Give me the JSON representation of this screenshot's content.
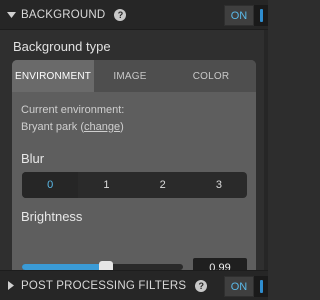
{
  "background_section": {
    "title": "BACKGROUND",
    "toggle_label": "ON",
    "help_glyph": "?",
    "background_type_label": "Background type",
    "tabs": [
      {
        "label": "ENVIRONMENT",
        "active": true
      },
      {
        "label": "IMAGE",
        "active": false
      },
      {
        "label": "COLOR",
        "active": false
      }
    ],
    "current_environment_label": "Current environment:",
    "environment_name": "Bryant park",
    "change_link": "change",
    "blur": {
      "label": "Blur",
      "options": [
        "0",
        "1",
        "2",
        "3"
      ],
      "selected": "0"
    },
    "brightness": {
      "label": "Brightness",
      "value": "0.99",
      "fraction": 0.52
    }
  },
  "post_processing_section": {
    "title": "POST PROCESSING FILTERS",
    "toggle_label": "ON",
    "help_glyph": "?"
  },
  "colors": {
    "accent": "#3b9bd6",
    "toggle_text": "#5ab9e8"
  }
}
